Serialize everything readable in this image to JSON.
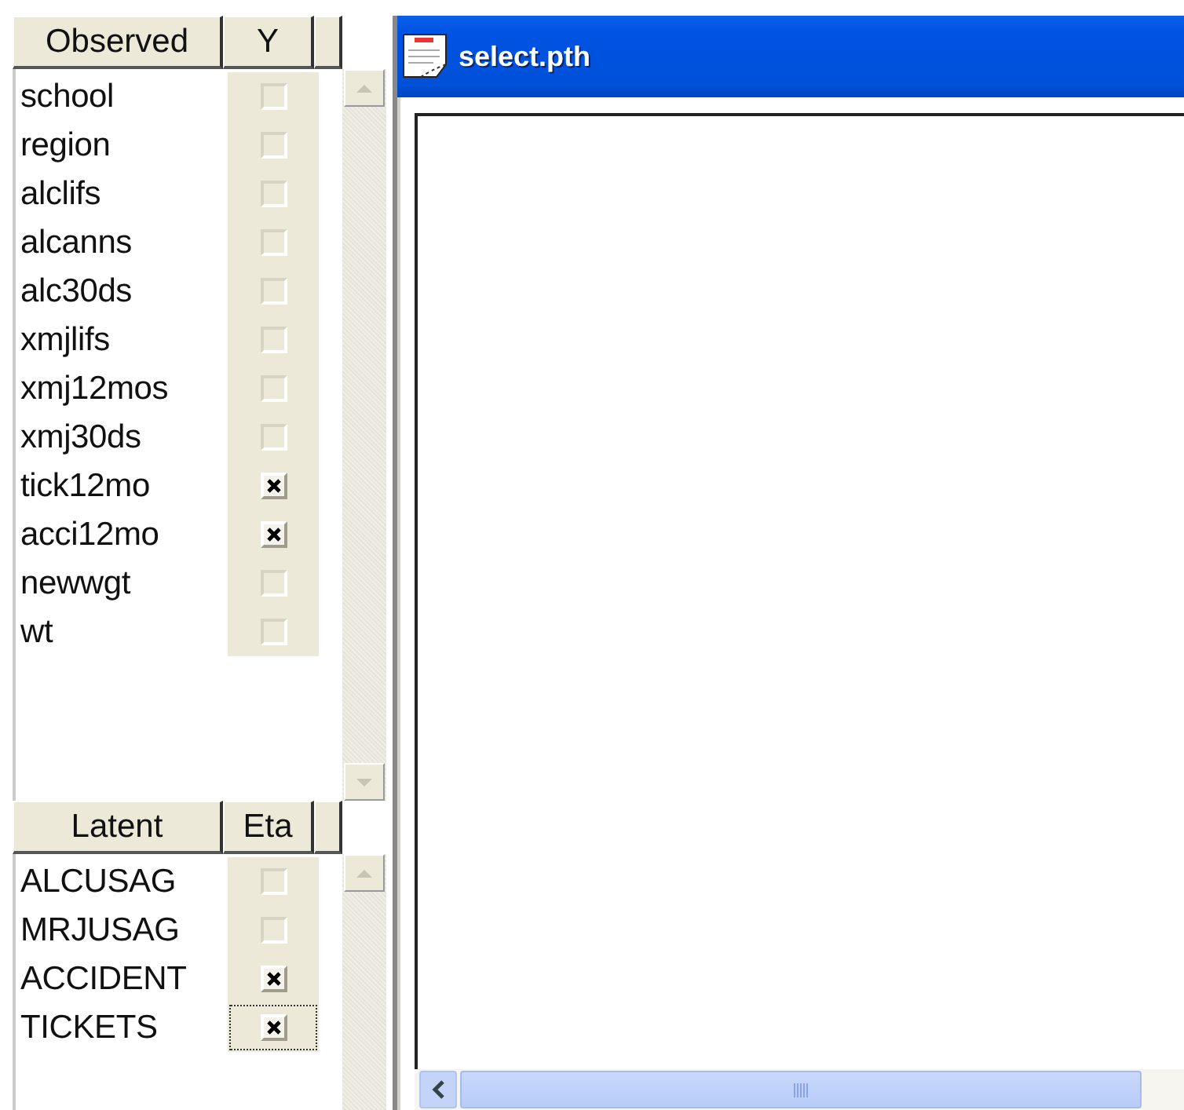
{
  "observed": {
    "columns": [
      "Observed",
      "Y"
    ],
    "rows": [
      {
        "name": "school",
        "checked": false
      },
      {
        "name": "region",
        "checked": false
      },
      {
        "name": "alclifs",
        "checked": false
      },
      {
        "name": "alcanns",
        "checked": false
      },
      {
        "name": "alc30ds",
        "checked": false
      },
      {
        "name": "xmjlifs",
        "checked": false
      },
      {
        "name": "xmj12mos",
        "checked": false
      },
      {
        "name": "xmj30ds",
        "checked": false
      },
      {
        "name": "tick12mo",
        "checked": true
      },
      {
        "name": "acci12mo",
        "checked": true
      },
      {
        "name": "newwgt",
        "checked": false
      },
      {
        "name": "wt",
        "checked": false
      }
    ]
  },
  "latent": {
    "columns": [
      "Latent",
      "Eta"
    ],
    "rows": [
      {
        "name": "ALCUSAG",
        "checked": false,
        "focused": false
      },
      {
        "name": "MRJUSAG",
        "checked": false,
        "focused": false
      },
      {
        "name": "ACCIDENT",
        "checked": true,
        "focused": false
      },
      {
        "name": "TICKETS",
        "checked": true,
        "focused": true
      }
    ]
  },
  "window": {
    "title": "select.pth"
  }
}
